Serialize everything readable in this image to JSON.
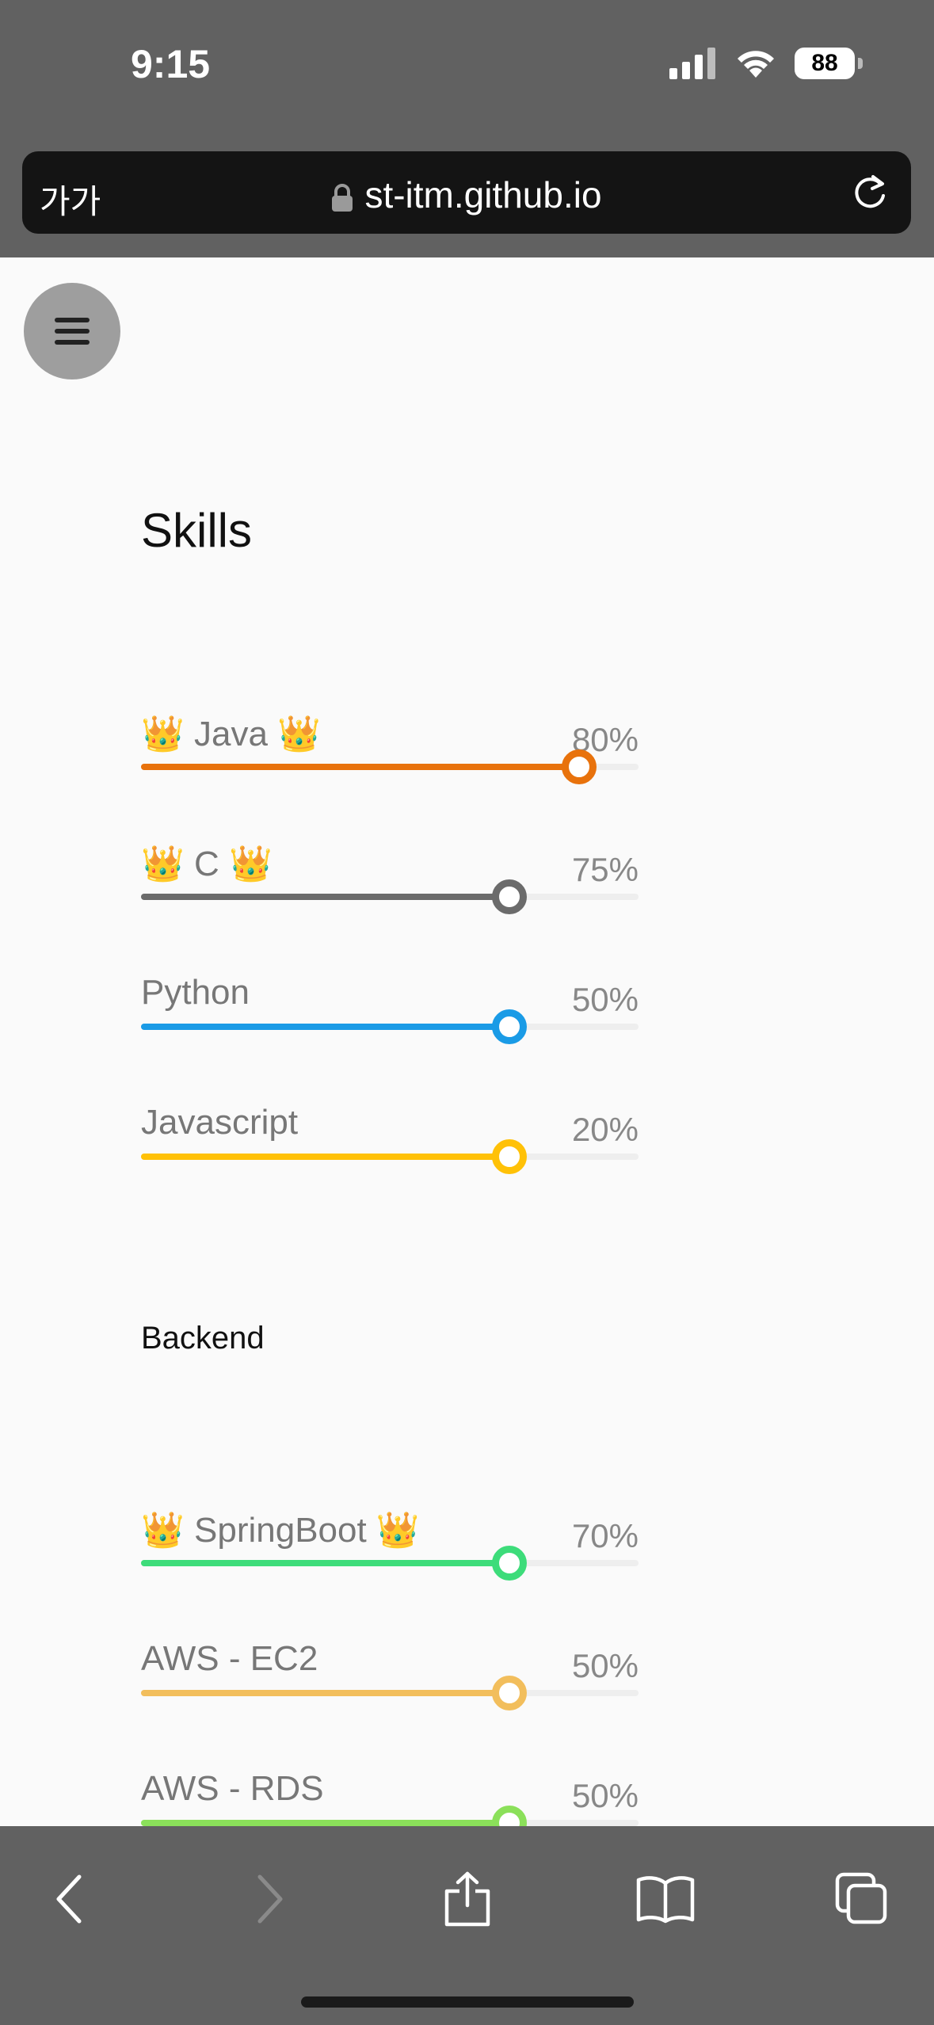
{
  "status_bar": {
    "time": "9:15",
    "battery": "88"
  },
  "browser": {
    "text_size_label": "가가",
    "url": "st-itm.github.io"
  },
  "page": {
    "title": "Skills",
    "languages": [
      {
        "name": "👑 Java 👑",
        "percent_label": "80%",
        "value": 0.88,
        "color": "#E8720C"
      },
      {
        "name": "👑 C 👑",
        "percent_label": "75%",
        "value": 0.74,
        "color": "#6B6B6B"
      },
      {
        "name": "Python",
        "percent_label": "50%",
        "value": 0.74,
        "color": "#1A9BE6"
      },
      {
        "name": "Javascript",
        "percent_label": "20%",
        "value": 0.74,
        "color": "#FFC107"
      }
    ],
    "backend_title": "Backend",
    "backend": [
      {
        "name": "👑 SpringBoot 👑",
        "percent_label": "70%",
        "value": 0.74,
        "color": "#3DDC7A"
      },
      {
        "name": "AWS - EC2",
        "percent_label": "50%",
        "value": 0.74,
        "color": "#F2BE5C"
      },
      {
        "name": "AWS - RDS",
        "percent_label": "50%",
        "value": 0.74,
        "color": "#8BE05A"
      }
    ]
  }
}
